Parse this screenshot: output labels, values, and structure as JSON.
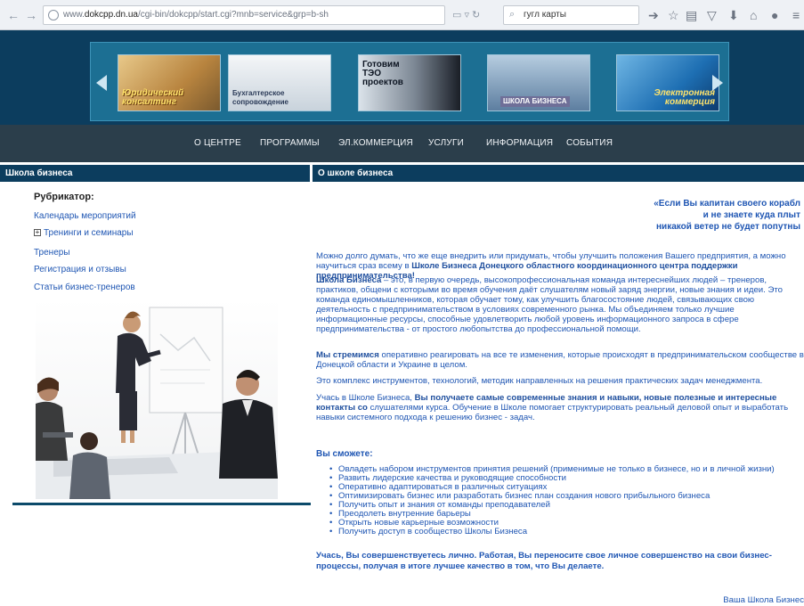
{
  "browser": {
    "url_prefix": "www.",
    "url_host": "dokcpp.dn.ua",
    "url_path": "/cgi-bin/dokcpp/start.cgi?mnb=service&grp=b-sh",
    "search_value": "гугл карты"
  },
  "banner": {
    "slides": [
      {
        "caption": "Юридический\nконсалтинг"
      },
      {
        "caption": "Бухгалтерское\nсопровождение"
      },
      {
        "caption": "Готовим\nТЭО\nпроектов"
      },
      {
        "caption": "ШКОЛА БИЗНЕСА"
      },
      {
        "caption": "Электронная\nкоммерция"
      }
    ]
  },
  "menu": [
    "О ЦЕНТРЕ",
    "ПРОГРАММЫ",
    "ЭЛ.КОММЕРЦИЯ",
    "УСЛУГИ",
    "ИНФОРМАЦИЯ",
    "СОБЫТИЯ"
  ],
  "left": {
    "title": "Школа бизнеса",
    "rubricator_label": "Рубрикатор:",
    "items": [
      {
        "label": "Календарь мероприятий",
        "expander": ""
      },
      {
        "label": "Тренинги и семинары",
        "expander": "+"
      },
      {
        "label": "Тренеры",
        "expander": ""
      },
      {
        "label": "Регистрация и отзывы",
        "expander": ""
      },
      {
        "label": "Статьи бизнес-тренеров",
        "expander": ""
      }
    ]
  },
  "right": {
    "title": "О школе бизнеса",
    "quote": "«Если Вы капитан своего корабл\nи не  знаете куда плыт\nникакой ветер не будет попутны",
    "p1_text": "Можно долго думать, что же еще внедрить или придумать, чтобы улучшить положения Вашего предприятия, а можно научиться сраз всему в ",
    "p1_bold": "Школе Бизнеса Донецкого областного координационного центра поддержки предпринимательства!",
    "p2_bold": "Школа Бизнеса",
    "p2_text": " – это, в первую очередь, высокопрофессиональная команда интереснейших людей – тренеров, практиков, общени с которыми во время обучения даёт слушателям новый заряд энергии, новые знания и идеи. Это команда единомышленников, которая обучает тому, как улучшить благосостояние людей, связывающих свою деятельность с предпринимательством в условиях современного рынка. Мы объединяем только лучшие информационные ресурсы, способные удовлетворить любой уровень информационного запроса в сфере предпринимательства - от простого любопытства до профессиональной помощи.",
    "p3_bold": "Мы стремимся",
    "p3_text": " оперативно реагировать на все те изменения, которые происходят в предпринимательском сообществе в Донецкой области и Украине в целом.",
    "p4_text": "Это комплекс инструментов, технологий, методик направленных на решения практических задач менеджмента.",
    "p5_text_a": "Учась в Школе Бизнеса, ",
    "p5_bold": "Вы получаете самые современные знания и навыки, новые полезные и интересные контакты со",
    "p5_text_b": " слушателями курса. Обучение в Школе помогает структурировать реальный деловой опыт и выработать навыки системного подхода к решению бизнес - задач.",
    "you_can_label": "Вы сможете:",
    "bullets": [
      "Овладеть набором инструментов принятия решений (применимые не только в бизнесе, но и в личной жизни)",
      "Развить лидерские качества и руководящие способности",
      "Оперативно адаптироваться в различных ситуациях",
      "Оптимизировать бизнес или разработать бизнес план создания нового прибыльного бизнеса",
      "Получить опыт и знания от команды преподавателей",
      "Преодолеть внутренние барьеры",
      "Открыть новые карьерные возможности",
      " Получить доступ в сообщество Школы Бизнеса"
    ],
    "closing": "Учась, Вы совершенствуетесь лично. Работая, Вы переносите свое личное совершенство на свои бизнес-процессы, получая в итоге лучшее качество в том, что Вы делаете.",
    "signature": "Ваша Школа Бизнес"
  }
}
